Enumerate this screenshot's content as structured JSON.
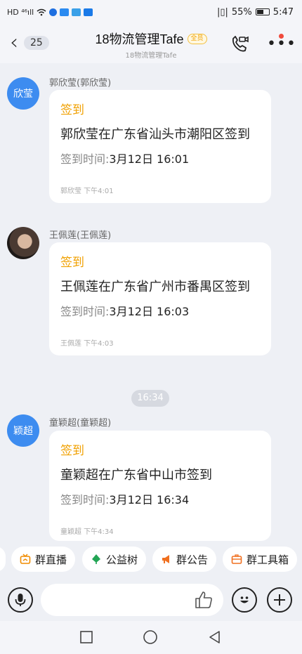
{
  "status_bar": {
    "left_text": "HD ⁴⁶ıll",
    "battery_percent": "55%",
    "battery_level": 0.55,
    "time": "5:47"
  },
  "header": {
    "unread_count": "25",
    "title": "18物流管理Tafe",
    "member_tag": "全员",
    "subtitle": "18物流管理Tafe",
    "icons": [
      "back-chevron-icon",
      "video-call-icon",
      "more-icon"
    ]
  },
  "messages": [
    {
      "avatar_text": "欣莹",
      "sender": "郭欣莹(郭欣莹)",
      "card_title": "签到",
      "card_body": "郭欣莹在广东省汕头市潮阳区签到",
      "time_label": "签到时间:",
      "time_value": "3月12日 16:01",
      "footer": "郭欣莹 下午4:01"
    },
    {
      "avatar_text": "",
      "sender": "王佩莲(王佩莲)",
      "card_title": "签到",
      "card_body": "王佩莲在广东省广州市番禺区签到",
      "time_label": "签到时间:",
      "time_value": "3月12日 16:03",
      "footer": "王佩莲 下午4:03"
    },
    {
      "avatar_text": "颖超",
      "sender": "童颖超(童颖超)",
      "card_title": "签到",
      "card_body": "童颖超在广东省中山市签到",
      "time_label": "签到时间:",
      "time_value": "3月12日 16:34",
      "footer": "童颖超 下午4:34"
    }
  ],
  "time_divider": "16:34",
  "toolbar": {
    "items": [
      {
        "label": "群直播",
        "icon": "live-tv-icon"
      },
      {
        "label": "公益树",
        "icon": "tree-icon"
      },
      {
        "label": "群公告",
        "icon": "megaphone-icon"
      },
      {
        "label": "群工具箱",
        "icon": "toolbox-icon"
      }
    ]
  },
  "input_bar": {
    "placeholder": "",
    "icons": [
      "voice-icon",
      "thumbs-up-icon",
      "emoji-icon",
      "plus-icon"
    ]
  },
  "nav_bar": {
    "icons": [
      "recents-square-icon",
      "home-circle-icon",
      "back-triangle-icon"
    ]
  },
  "colors": {
    "accent_orange": "#f0a000",
    "avatar_blue": "#3d8cf0",
    "background": "#eef0f5",
    "notification_red": "#f04a3c"
  }
}
